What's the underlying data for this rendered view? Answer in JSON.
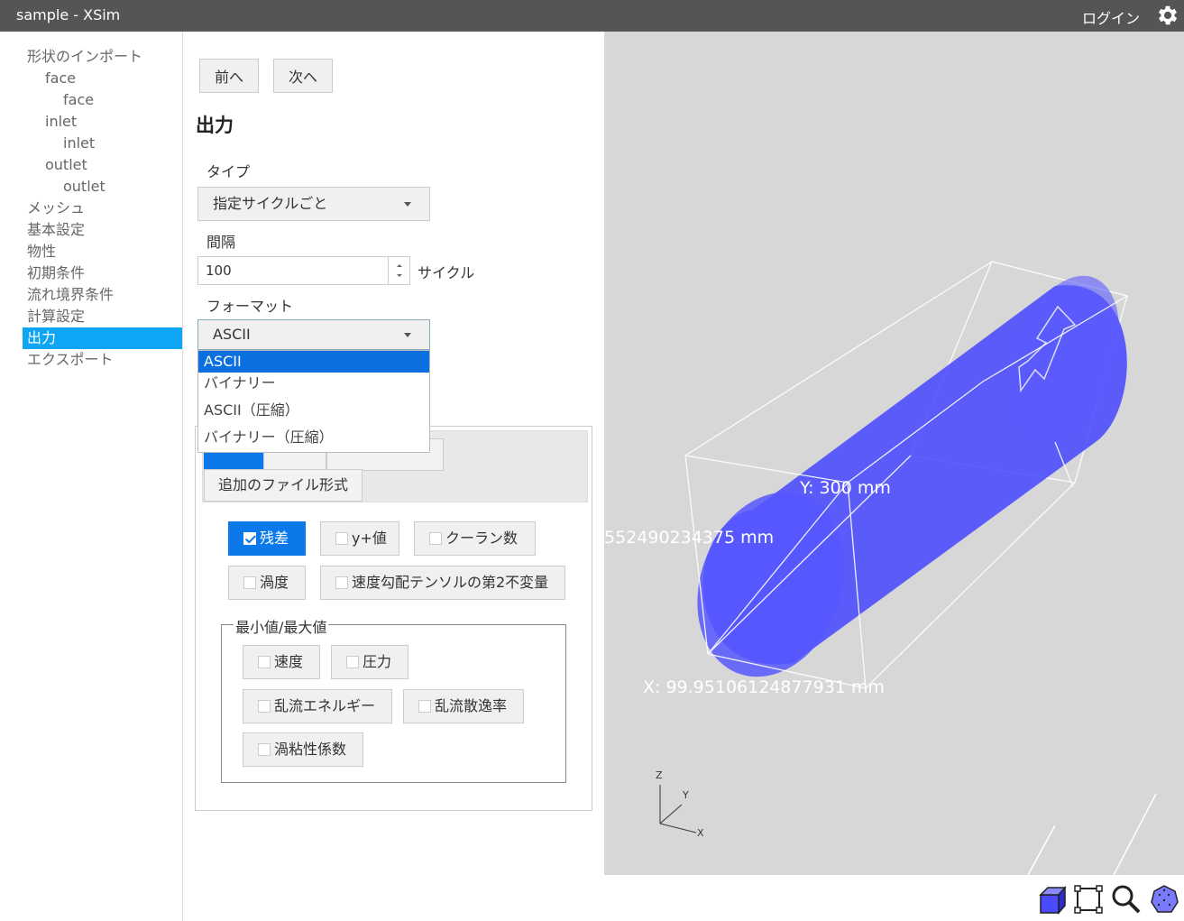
{
  "app": {
    "title": "sample - XSim",
    "login": "ログイン"
  },
  "sidebar": {
    "items": [
      {
        "label": "形状のインポート",
        "level": 0
      },
      {
        "label": "face",
        "level": 1
      },
      {
        "label": "face",
        "level": 2
      },
      {
        "label": "inlet",
        "level": 1
      },
      {
        "label": "inlet",
        "level": 2
      },
      {
        "label": "outlet",
        "level": 1
      },
      {
        "label": "outlet",
        "level": 2
      },
      {
        "label": "メッシュ",
        "level": 0
      },
      {
        "label": "基本設定",
        "level": 0
      },
      {
        "label": "物性",
        "level": 0
      },
      {
        "label": "初期条件",
        "level": 0
      },
      {
        "label": "流れ境界条件",
        "level": 0
      },
      {
        "label": "計算設定",
        "level": 0
      },
      {
        "label": "出力",
        "level": 0,
        "active": true
      },
      {
        "label": "エクスポート",
        "level": 0
      }
    ]
  },
  "main": {
    "prev": "前へ",
    "next": "次へ",
    "heading": "出力",
    "type_label": "タイプ",
    "type_value": "指定サイクルごと",
    "interval_label": "間隔",
    "interval_value": "100",
    "interval_unit": "サイクル",
    "format_label": "フォーマット",
    "format_value": "ASCII",
    "format_options": [
      "ASCII",
      "バイナリー",
      "ASCII（圧縮）",
      "バイナリー（圧縮）"
    ],
    "tab_extra": "追加のファイル形式",
    "checks": {
      "residual": "残差",
      "yplus": "y+値",
      "courant": "クーラン数",
      "vorticity": "渦度",
      "q_criterion": "速度勾配テンソルの第2不変量"
    },
    "minmax": {
      "legend": "最小値/最大値",
      "velocity": "速度",
      "pressure": "圧力",
      "tke": "乱流エネルギー",
      "dissipation": "乱流散逸率",
      "eddy_visc": "渦粘性係数"
    }
  },
  "viewer": {
    "dim_y": "Y: 300 mm",
    "dim_z": "552490234375 mm",
    "dim_x": "X: 99.95106124877931 mm",
    "axes": {
      "z": "Z",
      "y": "Y",
      "x": "X"
    },
    "cylinder_color": "#4a4aff"
  },
  "toolbar": {
    "icons": [
      "view-cube-icon",
      "fit-frame-icon",
      "zoom-icon",
      "sphere-mesh-icon"
    ]
  }
}
